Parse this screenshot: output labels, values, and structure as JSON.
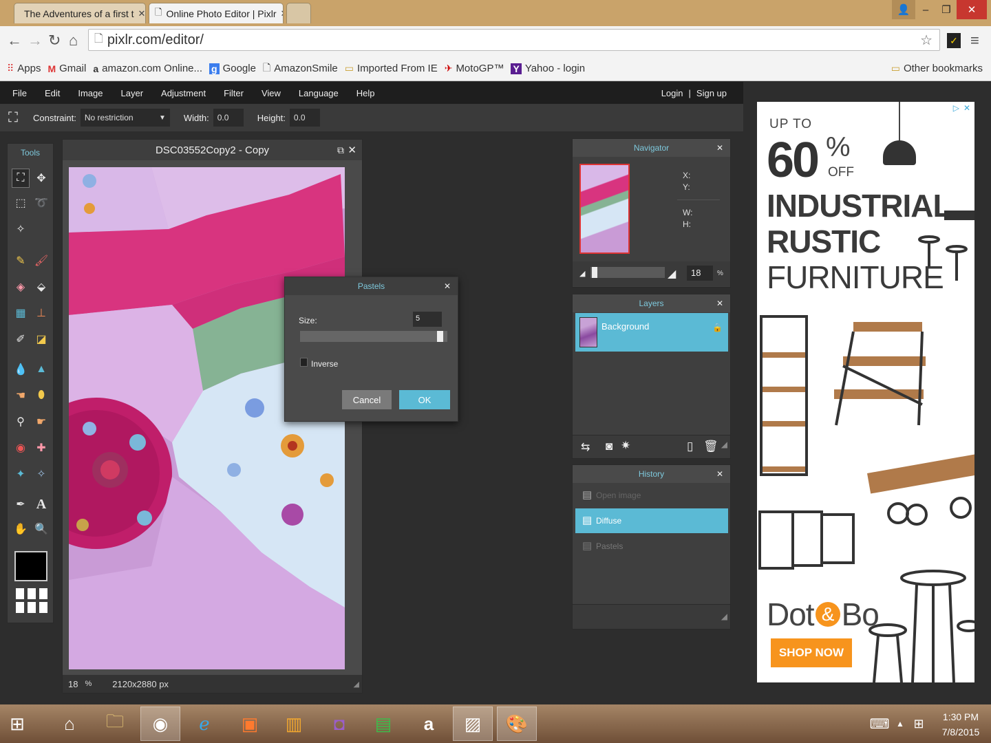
{
  "browser": {
    "tabs": [
      {
        "title": "The Adventures of a first t",
        "active": false
      },
      {
        "title": "Online Photo Editor | Pixlr",
        "active": true
      }
    ],
    "url": "pixlr.com/editor/",
    "bookmarks": [
      "Apps",
      "Gmail",
      "amazon.com Online...",
      "Google",
      "AmazonSmile",
      "Imported From IE",
      "MotoGP™",
      "Yahoo - login"
    ],
    "other_bookmarks": "Other bookmarks"
  },
  "menu": {
    "items": [
      "File",
      "Edit",
      "Image",
      "Layer",
      "Adjustment",
      "Filter",
      "View",
      "Language",
      "Help"
    ],
    "login": "Login",
    "separator": "|",
    "signup": "Sign up"
  },
  "options": {
    "constraint_label": "Constraint:",
    "constraint_value": "No restriction",
    "width_label": "Width:",
    "width_value": "0.0",
    "height_label": "Height:",
    "height_value": "0.0"
  },
  "tools": {
    "title": "Tools"
  },
  "document": {
    "title": "DSC03552Copy2 - Copy",
    "zoom": "18",
    "zoom_unit": "%",
    "dimensions": "2120x2880 px"
  },
  "navigator": {
    "title": "Navigator",
    "x_label": "X:",
    "y_label": "Y:",
    "w_label": "W:",
    "h_label": "H:",
    "zoom": "18",
    "zoom_unit": "%"
  },
  "layers": {
    "title": "Layers",
    "items": [
      "Background"
    ]
  },
  "history": {
    "title": "History",
    "items": [
      {
        "label": "Open image",
        "state": "dim"
      },
      {
        "label": "Diffuse",
        "state": "selected"
      },
      {
        "label": "Pastels",
        "state": "dim"
      }
    ]
  },
  "dialog": {
    "title": "Pastels",
    "size_label": "Size:",
    "size_value": "5",
    "slider_level": 0.97,
    "inverse_label": "Inverse",
    "cancel": "Cancel",
    "ok": "OK"
  },
  "ad": {
    "line1": "UP TO",
    "percent": "60",
    "percent_sign": "%",
    "off": "OFF",
    "line2": "INDUSTRIAL",
    "line3": "RUSTIC",
    "line4": "FURNITURE",
    "brand_a": "Dot",
    "brand_amp": "&",
    "brand_b": "Bo",
    "cta": "SHOP NOW"
  },
  "taskbar": {
    "time": "1:30 PM",
    "date": "7/8/2015"
  },
  "colors": {
    "accent": "#5bbad5",
    "ok_button": "#5bbad5",
    "ad_cta": "#f7941d"
  }
}
